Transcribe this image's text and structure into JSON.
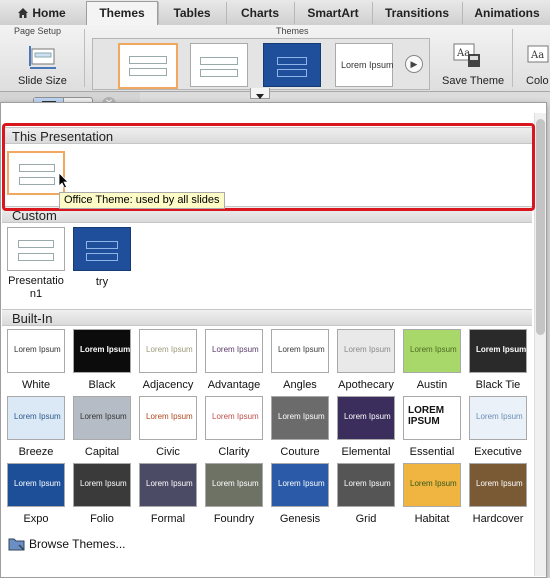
{
  "tabs": [
    "Home",
    "Themes",
    "Tables",
    "Charts",
    "SmartArt",
    "Transitions",
    "Animations"
  ],
  "ribbon": {
    "page_setup_group": "Page Setup",
    "slide_size": "Slide Size",
    "themes_group": "Themes",
    "gallery_lorem": "Lorem Ipsum",
    "save_theme": "Save Theme",
    "colors_partial": "Colo"
  },
  "gallery": {
    "section_this": "This Presentation",
    "section_custom": "Custom",
    "section_builtin": "Built-In",
    "tooltip": "Office Theme: used by all slides",
    "custom_items": [
      "Presentatio n1",
      "try"
    ],
    "lorem": "Lorem Ipsum",
    "lorem_caps": "LOREM IPSUM",
    "builtin": [
      {
        "name": "White",
        "bg": "#ffffff",
        "fg": "#333333"
      },
      {
        "name": "Black",
        "bg": "#0c0c0c",
        "fg": "#ffffff"
      },
      {
        "name": "Adjacency",
        "bg": "#ffffff",
        "fg": "#9b9b7c"
      },
      {
        "name": "Advantage",
        "bg": "#ffffff",
        "fg": "#5a3a6a"
      },
      {
        "name": "Angles",
        "bg": "#ffffff",
        "fg": "#3b3b3b"
      },
      {
        "name": "Apothecary",
        "bg": "#e9e9e9",
        "fg": "#8a8a8a"
      },
      {
        "name": "Austin",
        "bg": "#a8d86a",
        "fg": "#4d6b22"
      },
      {
        "name": "Black Tie",
        "bg": "#2a2a2a",
        "fg": "#ffffff"
      },
      {
        "name": "Breeze",
        "bg": "#dbe9f7",
        "fg": "#2e5a8a"
      },
      {
        "name": "Capital",
        "bg": "#b5bcc6",
        "fg": "#333333"
      },
      {
        "name": "Civic",
        "bg": "#ffffff",
        "fg": "#b0471e"
      },
      {
        "name": "Clarity",
        "bg": "#ffffff",
        "fg": "#c0504d"
      },
      {
        "name": "Couture",
        "bg": "#6b6b6b",
        "fg": "#ffffff"
      },
      {
        "name": "Elemental",
        "bg": "#3b2d5c",
        "fg": "#ffffff"
      },
      {
        "name": "Essential",
        "bg": "#ffffff",
        "fg": "#111111"
      },
      {
        "name": "Executive",
        "bg": "#eaf1f8",
        "fg": "#6b8fb6"
      },
      {
        "name": "Expo",
        "bg": "#1d4f98",
        "fg": "#ffffff"
      },
      {
        "name": "Folio",
        "bg": "#3a3a3a",
        "fg": "#ffffff"
      },
      {
        "name": "Formal",
        "bg": "#4c4b66",
        "fg": "#ffffff"
      },
      {
        "name": "Foundry",
        "bg": "#6d7264",
        "fg": "#ffffff"
      },
      {
        "name": "Genesis",
        "bg": "#2a5aa8",
        "fg": "#ffffff"
      },
      {
        "name": "Grid",
        "bg": "#555555",
        "fg": "#ffffff"
      },
      {
        "name": "Habitat",
        "bg": "#f0b440",
        "fg": "#2f5a1f"
      },
      {
        "name": "Hardcover",
        "bg": "#7a5a35",
        "fg": "#ffffff"
      }
    ],
    "browse": "Browse Themes..."
  },
  "colors": {
    "highlight": "#d9161d",
    "accent_orange": "#f0a860",
    "blue_theme": "#1f4f9a"
  }
}
